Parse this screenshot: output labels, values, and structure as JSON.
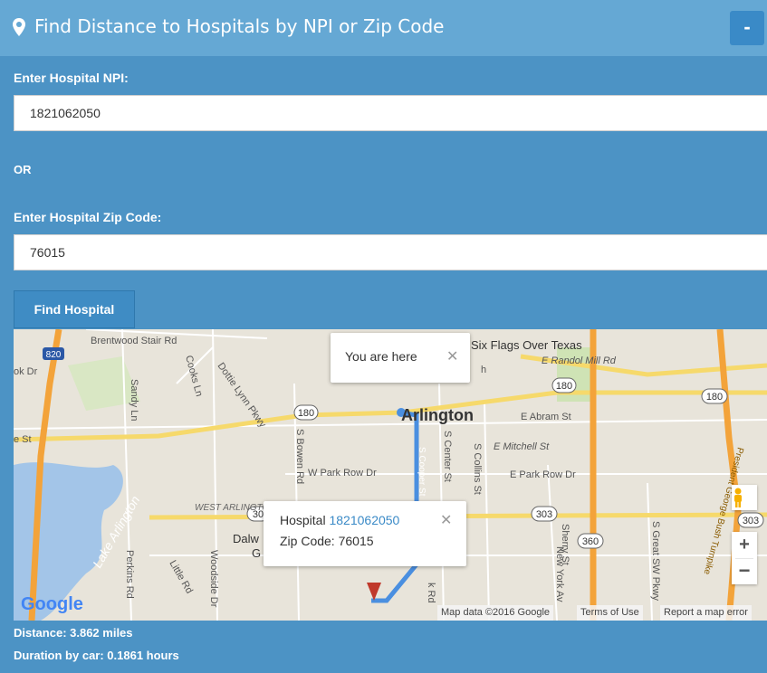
{
  "header": {
    "title": "Find Distance to Hospitals by NPI or Zip Code",
    "collapse_label": "-"
  },
  "form": {
    "npi_label": "Enter Hospital NPI:",
    "npi_value": "1821062050",
    "or_text": "OR",
    "zip_label": "Enter Hospital Zip Code:",
    "zip_value": "76015",
    "find_button": "Find Hospital"
  },
  "map": {
    "you_are_here": "You are here",
    "hospital_prefix": "Hospital",
    "hospital_npi": "1821062050",
    "zip_line": "Zip Code: 76015",
    "attribution": "Map data ©2016 Google",
    "terms": "Terms of Use",
    "report": "Report a map error",
    "google": "Google",
    "labels": {
      "brentwood": "Brentwood Stair Rd",
      "six_flags": "Six Flags Over Texas",
      "randol": "E Randol Mill Rd",
      "arlington": "Arlington",
      "abram": "E Abram St",
      "mitchell": "E Mitchell St",
      "park_row_e": "E Park Row Dr",
      "park_row_w": "W Park Row Dr",
      "lake_arlington": "Lake Arlington",
      "west_arlington": "WEST ARLINGTON",
      "dalw": "Dalw",
      "g": "G",
      "sandy": "Sandy Ln",
      "cooks": "Cooks Ln",
      "dottie": "Dottie Lynn Pkwy",
      "bowen": "S Bowen Rd",
      "center": "S Center St",
      "collins": "S Collins St",
      "cooper": "S Cooper St",
      "new_york": "New York Av",
      "sherry": "Sherry St",
      "great_sw": "S Great SW Pkwy",
      "perkins": "Perkins Rd",
      "little": "Little Rd",
      "woodside": "Woodside Dr",
      "kdr": "ok Dr",
      "est": "e St",
      "turnpike": "President George Bush Turnpike",
      "h": "h",
      "k_rd": "k Rd",
      "shields": [
        "820",
        "180",
        "180",
        "180",
        "303",
        "360",
        "303",
        "30"
      ]
    }
  },
  "footer": {
    "distance": "Distance: 3.862 miles",
    "duration": "Duration by car: 0.1861 hours"
  }
}
